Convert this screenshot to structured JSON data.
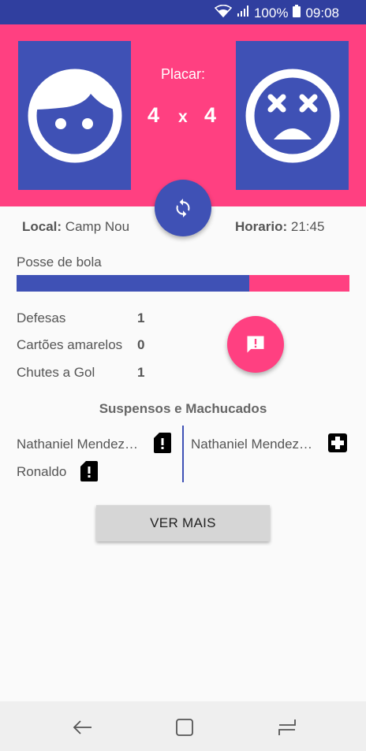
{
  "status_bar": {
    "battery": "100%",
    "time": "09:08",
    "icons": [
      "wifi-icon",
      "signal-icon",
      "battery-icon"
    ]
  },
  "header": {
    "placar_label": "Placar:",
    "score_home": "4",
    "score_separator": "x",
    "score_away": "4",
    "home_avatar": "happy-face-icon",
    "away_avatar": "dead-face-icon"
  },
  "info": {
    "local_label": "Local:",
    "local_value": "Camp Nou",
    "horario_label": "Horario:",
    "horario_value": "21:45"
  },
  "possession": {
    "label": "Posse de bola",
    "home_fraction": 0.7
  },
  "stats": [
    {
      "label": "Defesas",
      "value": "1"
    },
    {
      "label": "Cartões amarelos",
      "value": "0"
    },
    {
      "label": "Chutes a Gol",
      "value": "1"
    }
  ],
  "suspensos": {
    "title": "Suspensos e Machucados",
    "left": [
      {
        "name": "Nathaniel Mendez…",
        "icon": "card-alert-icon"
      },
      {
        "name": "Ronaldo",
        "icon": "card-alert-icon"
      }
    ],
    "right": [
      {
        "name": "Nathaniel Mendez…",
        "icon": "medical-cross-icon"
      }
    ]
  },
  "actions": {
    "ver_mais": "VER MAIS"
  },
  "colors": {
    "primary": "#3f51b5",
    "primary_dark": "#303f9f",
    "accent": "#ff4081"
  },
  "nav": [
    "back-icon",
    "home-icon",
    "recents-icon"
  ]
}
